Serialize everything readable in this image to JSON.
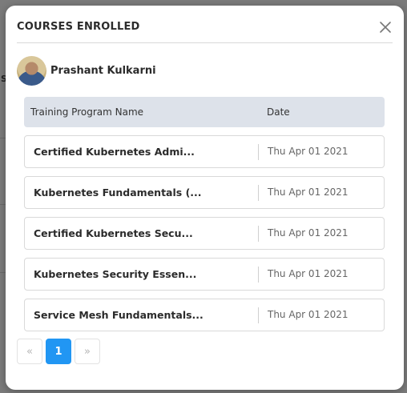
{
  "modal": {
    "title": "COURSES ENROLLED",
    "close_icon": "close-icon"
  },
  "user": {
    "name": "Prashant Kulkarni",
    "avatar_icon": "avatar"
  },
  "table": {
    "headers": {
      "name": "Training Program Name",
      "date": "Date"
    },
    "rows": [
      {
        "name": "Certified Kubernetes Admi...",
        "date": "Thu Apr 01 2021"
      },
      {
        "name": "Kubernetes Fundamentals (...",
        "date": "Thu Apr 01 2021"
      },
      {
        "name": "Certified Kubernetes Secu...",
        "date": "Thu Apr 01 2021"
      },
      {
        "name": "Kubernetes Security Essen...",
        "date": "Thu Apr 01 2021"
      },
      {
        "name": "Service Mesh Fundamentals...",
        "date": "Thu Apr 01 2021"
      }
    ]
  },
  "pagination": {
    "prev": "«",
    "current": "1",
    "next": "»"
  },
  "colors": {
    "accent": "#2196f3",
    "header_bg": "#dde2ea"
  }
}
